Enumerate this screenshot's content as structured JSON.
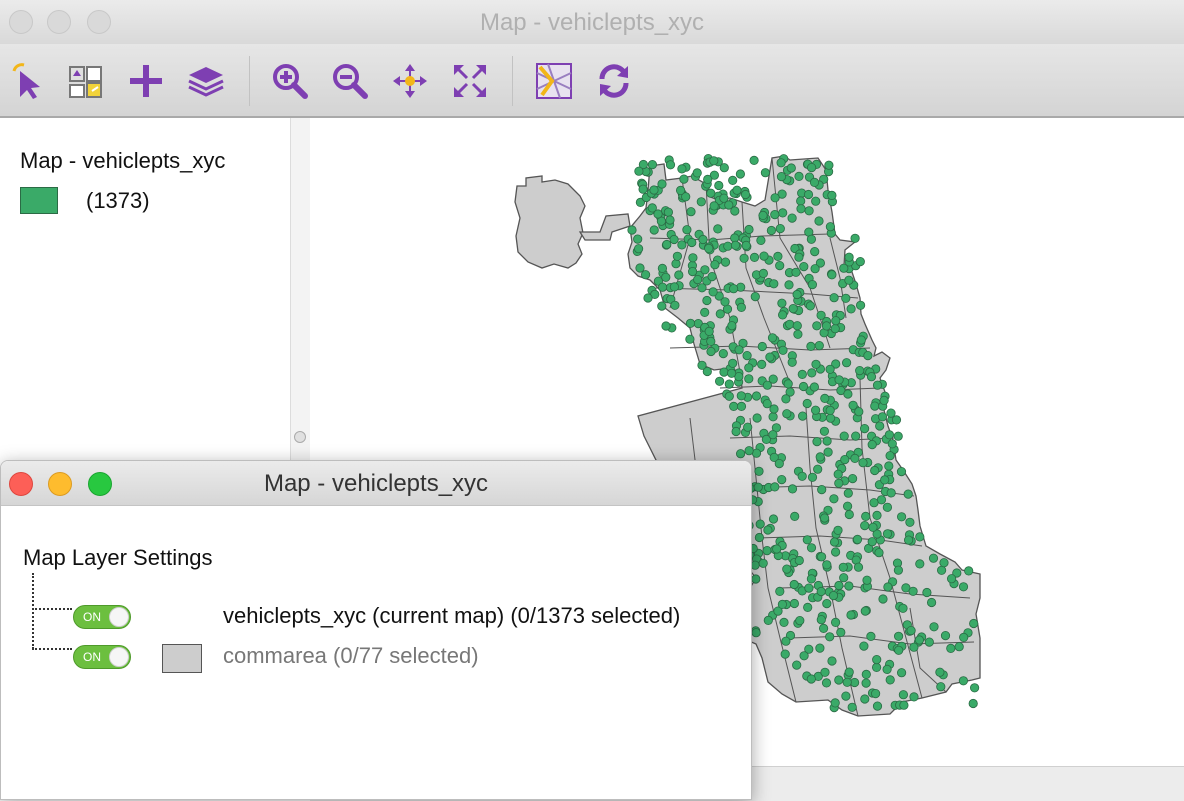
{
  "main_window": {
    "title": "Map - vehiclepts_xyc"
  },
  "toolbar": {
    "buttons": [
      {
        "name": "select-tool-icon"
      },
      {
        "name": "selection-shape-icon"
      },
      {
        "name": "add-layer-icon"
      },
      {
        "name": "layers-icon"
      },
      {
        "name": "zoom-in-icon"
      },
      {
        "name": "zoom-out-icon"
      },
      {
        "name": "pan-icon"
      },
      {
        "name": "full-extent-icon"
      },
      {
        "name": "basemap-icon"
      },
      {
        "name": "refresh-icon"
      }
    ],
    "icon_color": "#7e3fb2",
    "accent_color": "#f2b619"
  },
  "legend": {
    "title": "Map - vehiclepts_xyc",
    "count": "(1373)",
    "swatch_color": "#3aaa68"
  },
  "map": {
    "point_color": "#3aaa68",
    "area_fill": "#cdcdcd",
    "point_count": 1373,
    "area_count": 77
  },
  "settings_window": {
    "title": "Map - vehiclepts_xyc",
    "heading": "Map Layer Settings",
    "layers": [
      {
        "toggle": "ON",
        "label": "vehiclepts_xyc (current map) (0/1373 selected)"
      },
      {
        "toggle": "ON",
        "label": "commarea (0/77 selected)"
      }
    ]
  }
}
